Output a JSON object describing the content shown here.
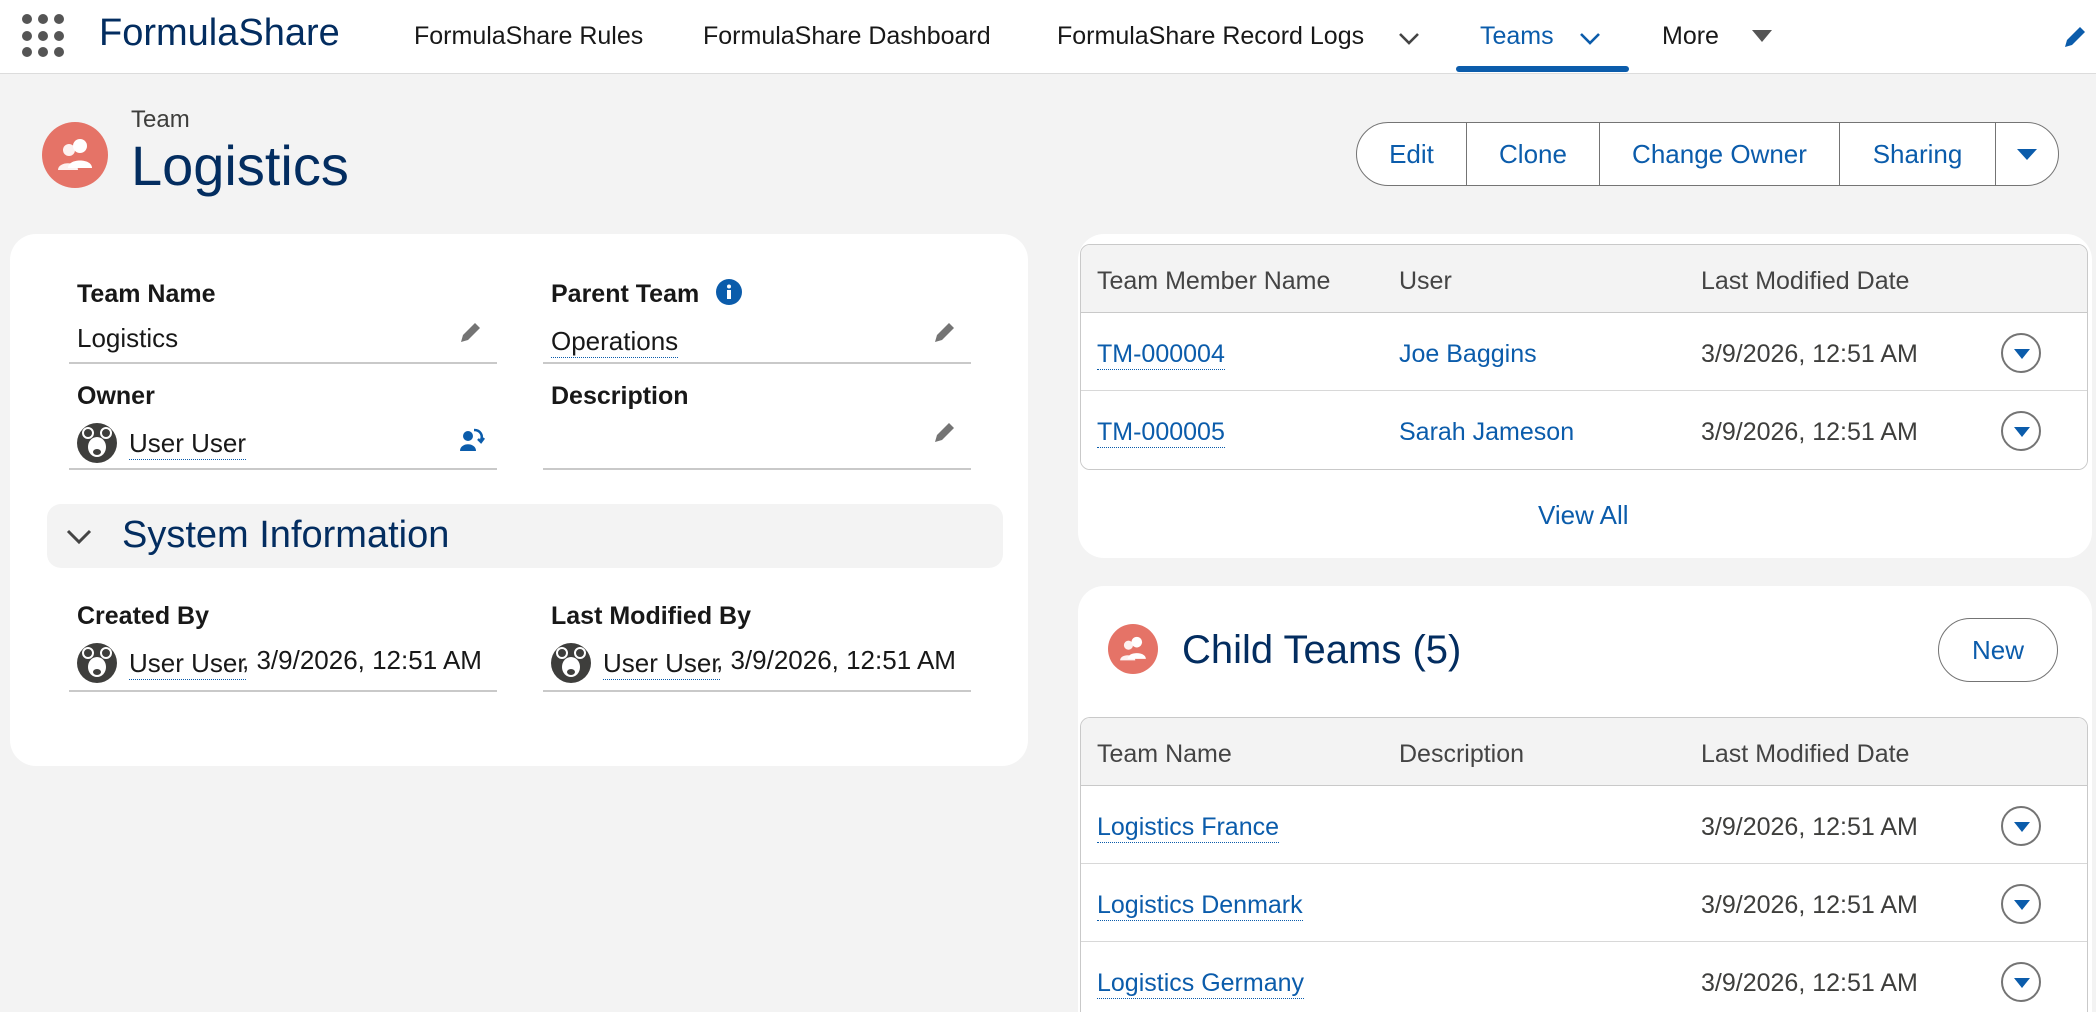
{
  "app": {
    "name": "FormulaShare"
  },
  "nav": {
    "items": [
      {
        "label": "FormulaShare Rules"
      },
      {
        "label": "FormulaShare Dashboard"
      },
      {
        "label": "FormulaShare Record Logs"
      },
      {
        "label": "Teams"
      },
      {
        "label": "More"
      }
    ]
  },
  "header": {
    "object_label": "Team",
    "record_name": "Logistics",
    "actions": [
      "Edit",
      "Clone",
      "Change Owner",
      "Sharing"
    ]
  },
  "details": {
    "team_name_label": "Team Name",
    "team_name_value": "Logistics",
    "parent_team_label": "Parent Team",
    "parent_team_value": "Operations",
    "owner_label": "Owner",
    "owner_value": "User User",
    "description_label": "Description",
    "description_value": "",
    "system_info_title": "System Information",
    "created_by_label": "Created By",
    "created_by_user": "User User",
    "created_by_date": ", 3/9/2026, 12:51 AM",
    "modified_by_label": "Last Modified By",
    "modified_by_user": "User User",
    "modified_by_date": ", 3/9/2026, 12:51 AM"
  },
  "team_members": {
    "columns": [
      "Team Member Name",
      "User",
      "Last Modified Date"
    ],
    "rows": [
      {
        "name": "TM-000004",
        "user": "Joe Baggins",
        "modified": "3/9/2026, 12:51 AM"
      },
      {
        "name": "TM-000005",
        "user": "Sarah Jameson",
        "modified": "3/9/2026, 12:51 AM"
      }
    ],
    "view_all": "View All"
  },
  "child_teams": {
    "title": "Child Teams (5)",
    "new_label": "New",
    "columns": [
      "Team Name",
      "Description",
      "Last Modified Date"
    ],
    "rows": [
      {
        "name": "Logistics France",
        "description": "",
        "modified": "3/9/2026, 12:51 AM"
      },
      {
        "name": "Logistics Denmark",
        "description": "",
        "modified": "3/9/2026, 12:51 AM"
      },
      {
        "name": "Logistics Germany",
        "description": "",
        "modified": "3/9/2026, 12:51 AM"
      }
    ]
  },
  "colors": {
    "brand_blue": "#0b5cab",
    "title_navy": "#032d60",
    "team_icon": "#e57367"
  }
}
